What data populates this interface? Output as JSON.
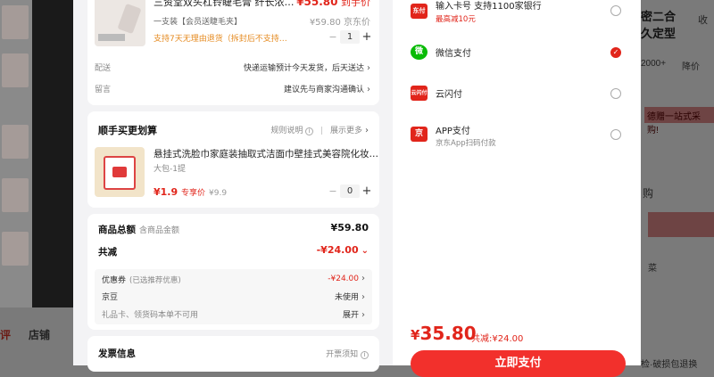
{
  "background": {
    "tabs": [
      "评",
      "店铺"
    ],
    "right_texts": [
      "密二合",
      "久定型",
      "2000+",
      "降价",
      "德赠一站式采购!",
      "购",
      "菜",
      "检·破损包退换"
    ],
    "right_icon_label": "收"
  },
  "product": {
    "title": "三资堂双头杠铃睫毛膏 纤长浓…",
    "price_current": "¥55.80",
    "price_tag": "到手价",
    "spec": "一支装【会员送睫毛夹】",
    "price_original": "¥59.80",
    "price_original_tag": "京东价",
    "return_policy": "支持7天无理由退货（拆封后不支持…",
    "quantity": "1",
    "stepper_minus": "−",
    "stepper_plus": "+"
  },
  "delivery": {
    "label": "配送",
    "value": "快递运输预计今天发货，后天送达"
  },
  "note": {
    "label": "留言",
    "value": "建议先与商家沟通确认"
  },
  "addon": {
    "section_title": "顺手买更划算",
    "rules_label": "规则说明",
    "show_more_label": "展示更多",
    "title": "悬挂式洗脸巾家庭装抽取式洁面巾壁挂式美容院化妆…",
    "spec": "大包-1提",
    "price": "¥1.9",
    "price_tag": "专享价",
    "price_original": "¥9.9",
    "quantity": "0",
    "stepper_minus": "−",
    "stepper_plus": "+"
  },
  "summary": {
    "total_label": "商品总额",
    "total_note": "含商品金额",
    "total_value": "¥59.80",
    "discount_label": "共减",
    "discount_value": "-¥24.00",
    "coupon_label": "优惠券",
    "coupon_note": "(已选推荐优惠)",
    "coupon_value": "-¥24.00",
    "jingdou_label": "京豆",
    "jingdou_value": "未使用",
    "giftcard_label": "礼品卡、领货码本单不可用",
    "giftcard_value": "展开"
  },
  "invoice": {
    "label": "发票信息",
    "link": "开票须知"
  },
  "payment": {
    "methods": [
      {
        "icon_text": "东付",
        "name": "输入卡号 支持1100家银行",
        "sub": "最高减10元",
        "selected": false,
        "color": "#e1251b"
      },
      {
        "icon_text": "微",
        "name": "微信支付",
        "sub": "",
        "selected": true,
        "color": "#09bb07"
      },
      {
        "icon_text": "云闪付",
        "name": "云闪付",
        "sub": "",
        "selected": false,
        "color": "#e1251b"
      },
      {
        "icon_text": "京",
        "name": "APP支付",
        "sub": "京东App扫码付款",
        "selected": false,
        "color": "#e1251b"
      }
    ],
    "check_mark": "✓",
    "total_yen": "¥",
    "total_amount": "35.80",
    "total_discount": "共减:¥24.00",
    "submit_label": "立即支付"
  }
}
